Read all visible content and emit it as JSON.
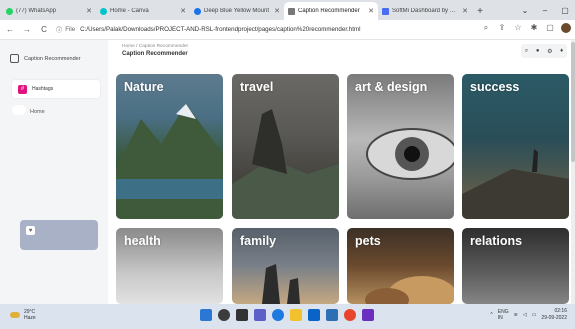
{
  "browser": {
    "tabs": [
      {
        "title": "(77) WhatsApp",
        "favicon_color": "#25d366"
      },
      {
        "title": "Home - Canva",
        "favicon_color": "#00c4cc"
      },
      {
        "title": "Deep Blue Yellow Mount",
        "favicon_color": "#1a73e8"
      },
      {
        "title": "Caption Recommender",
        "favicon_color": "#777777",
        "active": true
      },
      {
        "title": "SoftMi Dashboard by Cre",
        "favicon_color": "#4a6cf7"
      }
    ],
    "new_tab": "+",
    "window_controls": {
      "chevron": "⌄",
      "minimize": "–",
      "maximize": "▢"
    },
    "address": {
      "info_label": "File",
      "url": "C:/Users/Palak/Downloads/PROJECT-AND-RSL-frontendproject/pages/caption%20recommender.html"
    },
    "nav": {
      "back": "←",
      "forward": "→",
      "reload": "C",
      "info": "ⓘ"
    },
    "toolbar_icons": [
      "search-icon",
      "share-icon",
      "star-icon",
      "extensions-icon",
      "split-icon"
    ]
  },
  "sidebar": {
    "brand": "Caption Recommender",
    "active_item": "Hashtags",
    "home_item": "Home"
  },
  "header": {
    "breadcrumb": "Home / Caption Recommender",
    "title": "Caption Recommender",
    "icons": [
      "search-icon",
      "user-icon",
      "gear-icon",
      "bell-icon"
    ]
  },
  "categories": [
    {
      "id": "nature",
      "label": "Nature"
    },
    {
      "id": "travel",
      "label": "travel"
    },
    {
      "id": "art",
      "label": "art & design"
    },
    {
      "id": "success",
      "label": "success"
    },
    {
      "id": "health",
      "label": "health"
    },
    {
      "id": "family",
      "label": "family"
    },
    {
      "id": "pets",
      "label": "pets"
    },
    {
      "id": "relations",
      "label": "relations"
    }
  ],
  "taskbar": {
    "weather_temp": "29°C",
    "weather_desc": "Haze",
    "lang": "ENG",
    "region": "IN",
    "time": "02:16",
    "date": "29-09-2022"
  }
}
